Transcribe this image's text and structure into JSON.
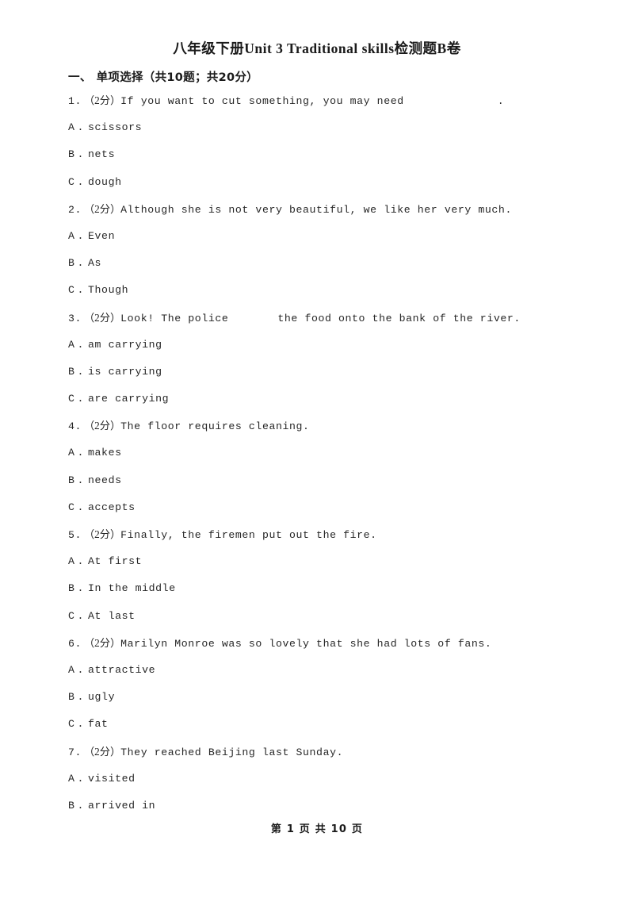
{
  "document": {
    "title": "八年级下册Unit 3 Traditional skills检测题B卷"
  },
  "section": {
    "number": "一、",
    "label": "单项选择（共10题；共20分）"
  },
  "questions": [
    {
      "number": "1.",
      "score": "（2分）",
      "text_before": "If you want to cut something, you may need",
      "gap": "tail",
      "text_after": ".",
      "options": [
        {
          "letter": "A",
          "dot": ".",
          "text": "scissors"
        },
        {
          "letter": "B",
          "dot": ".",
          "text": "nets"
        },
        {
          "letter": "C",
          "dot": ".",
          "text": "dough"
        }
      ]
    },
    {
      "number": "2.",
      "score": "（2分）",
      "text_before": "Although she is not very beautiful, we like her very much.",
      "gap": "none",
      "text_after": "",
      "options": [
        {
          "letter": "A",
          "dot": ".",
          "text": "Even"
        },
        {
          "letter": "B",
          "dot": ".",
          "text": "As"
        },
        {
          "letter": "C",
          "dot": ".",
          "text": "Though"
        }
      ]
    },
    {
      "number": "3.",
      "score": "（2分）",
      "text_before": "Look! The police",
      "gap": "mid",
      "text_after": "the food onto the bank of the river.",
      "options": [
        {
          "letter": "A",
          "dot": ".",
          "text": "am carrying"
        },
        {
          "letter": "B",
          "dot": ".",
          "text": "is carrying"
        },
        {
          "letter": "C",
          "dot": ".",
          "text": "are carrying"
        }
      ]
    },
    {
      "number": "4.",
      "score": "（2分）",
      "text_before": "The floor requires cleaning.",
      "gap": "none",
      "text_after": "",
      "options": [
        {
          "letter": "A",
          "dot": ".",
          "text": "makes"
        },
        {
          "letter": "B",
          "dot": ".",
          "text": "needs"
        },
        {
          "letter": "C",
          "dot": ".",
          "text": "accepts"
        }
      ]
    },
    {
      "number": "5.",
      "score": "（2分）",
      "text_before": "Finally, the firemen put out the fire.",
      "gap": "none",
      "text_after": "",
      "options": [
        {
          "letter": "A",
          "dot": ".",
          "text": "At first"
        },
        {
          "letter": "B",
          "dot": ".",
          "text": "In the middle"
        },
        {
          "letter": "C",
          "dot": ".",
          "text": "At last"
        }
      ]
    },
    {
      "number": "6.",
      "score": "（2分）",
      "text_before": "Marilyn Monroe was so lovely that she had lots of fans.",
      "gap": "none",
      "text_after": "",
      "options": [
        {
          "letter": "A",
          "dot": ".",
          "text": "attractive"
        },
        {
          "letter": "B",
          "dot": ".",
          "text": "ugly"
        },
        {
          "letter": "C",
          "dot": ".",
          "text": "fat"
        }
      ]
    },
    {
      "number": "7.",
      "score": "（2分）",
      "text_before": "They reached Beijing last Sunday.",
      "gap": "none",
      "text_after": "",
      "options": [
        {
          "letter": "A",
          "dot": ".",
          "text": "visited"
        },
        {
          "letter": "B",
          "dot": ".",
          "text": "arrived in"
        }
      ]
    }
  ],
  "footer": {
    "text": "第 1 页 共 10 页"
  }
}
